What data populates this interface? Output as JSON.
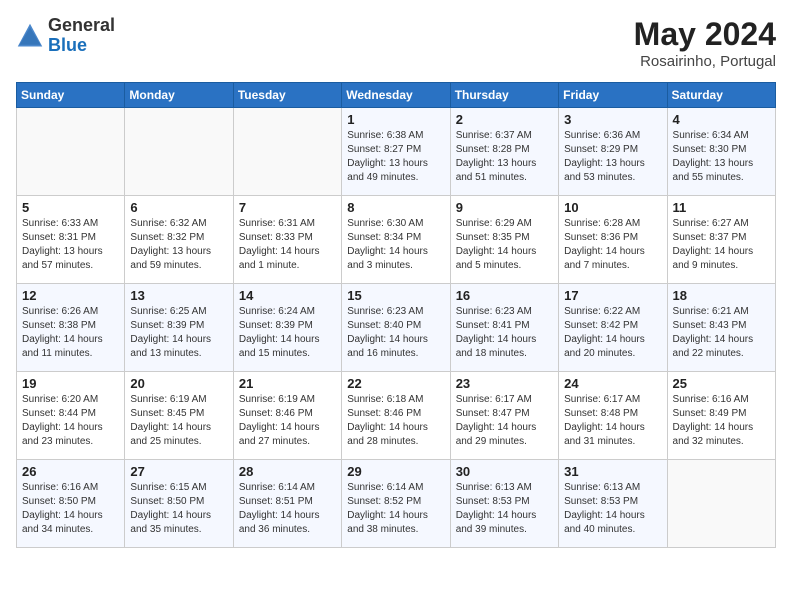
{
  "header": {
    "logo_general": "General",
    "logo_blue": "Blue",
    "month_title": "May 2024",
    "location": "Rosairinho, Portugal"
  },
  "days_of_week": [
    "Sunday",
    "Monday",
    "Tuesday",
    "Wednesday",
    "Thursday",
    "Friday",
    "Saturday"
  ],
  "weeks": [
    [
      {
        "day": "",
        "info": ""
      },
      {
        "day": "",
        "info": ""
      },
      {
        "day": "",
        "info": ""
      },
      {
        "day": "1",
        "info": "Sunrise: 6:38 AM\nSunset: 8:27 PM\nDaylight: 13 hours\nand 49 minutes."
      },
      {
        "day": "2",
        "info": "Sunrise: 6:37 AM\nSunset: 8:28 PM\nDaylight: 13 hours\nand 51 minutes."
      },
      {
        "day": "3",
        "info": "Sunrise: 6:36 AM\nSunset: 8:29 PM\nDaylight: 13 hours\nand 53 minutes."
      },
      {
        "day": "4",
        "info": "Sunrise: 6:34 AM\nSunset: 8:30 PM\nDaylight: 13 hours\nand 55 minutes."
      }
    ],
    [
      {
        "day": "5",
        "info": "Sunrise: 6:33 AM\nSunset: 8:31 PM\nDaylight: 13 hours\nand 57 minutes."
      },
      {
        "day": "6",
        "info": "Sunrise: 6:32 AM\nSunset: 8:32 PM\nDaylight: 13 hours\nand 59 minutes."
      },
      {
        "day": "7",
        "info": "Sunrise: 6:31 AM\nSunset: 8:33 PM\nDaylight: 14 hours\nand 1 minute."
      },
      {
        "day": "8",
        "info": "Sunrise: 6:30 AM\nSunset: 8:34 PM\nDaylight: 14 hours\nand 3 minutes."
      },
      {
        "day": "9",
        "info": "Sunrise: 6:29 AM\nSunset: 8:35 PM\nDaylight: 14 hours\nand 5 minutes."
      },
      {
        "day": "10",
        "info": "Sunrise: 6:28 AM\nSunset: 8:36 PM\nDaylight: 14 hours\nand 7 minutes."
      },
      {
        "day": "11",
        "info": "Sunrise: 6:27 AM\nSunset: 8:37 PM\nDaylight: 14 hours\nand 9 minutes."
      }
    ],
    [
      {
        "day": "12",
        "info": "Sunrise: 6:26 AM\nSunset: 8:38 PM\nDaylight: 14 hours\nand 11 minutes."
      },
      {
        "day": "13",
        "info": "Sunrise: 6:25 AM\nSunset: 8:39 PM\nDaylight: 14 hours\nand 13 minutes."
      },
      {
        "day": "14",
        "info": "Sunrise: 6:24 AM\nSunset: 8:39 PM\nDaylight: 14 hours\nand 15 minutes."
      },
      {
        "day": "15",
        "info": "Sunrise: 6:23 AM\nSunset: 8:40 PM\nDaylight: 14 hours\nand 16 minutes."
      },
      {
        "day": "16",
        "info": "Sunrise: 6:23 AM\nSunset: 8:41 PM\nDaylight: 14 hours\nand 18 minutes."
      },
      {
        "day": "17",
        "info": "Sunrise: 6:22 AM\nSunset: 8:42 PM\nDaylight: 14 hours\nand 20 minutes."
      },
      {
        "day": "18",
        "info": "Sunrise: 6:21 AM\nSunset: 8:43 PM\nDaylight: 14 hours\nand 22 minutes."
      }
    ],
    [
      {
        "day": "19",
        "info": "Sunrise: 6:20 AM\nSunset: 8:44 PM\nDaylight: 14 hours\nand 23 minutes."
      },
      {
        "day": "20",
        "info": "Sunrise: 6:19 AM\nSunset: 8:45 PM\nDaylight: 14 hours\nand 25 minutes."
      },
      {
        "day": "21",
        "info": "Sunrise: 6:19 AM\nSunset: 8:46 PM\nDaylight: 14 hours\nand 27 minutes."
      },
      {
        "day": "22",
        "info": "Sunrise: 6:18 AM\nSunset: 8:46 PM\nDaylight: 14 hours\nand 28 minutes."
      },
      {
        "day": "23",
        "info": "Sunrise: 6:17 AM\nSunset: 8:47 PM\nDaylight: 14 hours\nand 29 minutes."
      },
      {
        "day": "24",
        "info": "Sunrise: 6:17 AM\nSunset: 8:48 PM\nDaylight: 14 hours\nand 31 minutes."
      },
      {
        "day": "25",
        "info": "Sunrise: 6:16 AM\nSunset: 8:49 PM\nDaylight: 14 hours\nand 32 minutes."
      }
    ],
    [
      {
        "day": "26",
        "info": "Sunrise: 6:16 AM\nSunset: 8:50 PM\nDaylight: 14 hours\nand 34 minutes."
      },
      {
        "day": "27",
        "info": "Sunrise: 6:15 AM\nSunset: 8:50 PM\nDaylight: 14 hours\nand 35 minutes."
      },
      {
        "day": "28",
        "info": "Sunrise: 6:14 AM\nSunset: 8:51 PM\nDaylight: 14 hours\nand 36 minutes."
      },
      {
        "day": "29",
        "info": "Sunrise: 6:14 AM\nSunset: 8:52 PM\nDaylight: 14 hours\nand 38 minutes."
      },
      {
        "day": "30",
        "info": "Sunrise: 6:13 AM\nSunset: 8:53 PM\nDaylight: 14 hours\nand 39 minutes."
      },
      {
        "day": "31",
        "info": "Sunrise: 6:13 AM\nSunset: 8:53 PM\nDaylight: 14 hours\nand 40 minutes."
      },
      {
        "day": "",
        "info": ""
      }
    ]
  ]
}
